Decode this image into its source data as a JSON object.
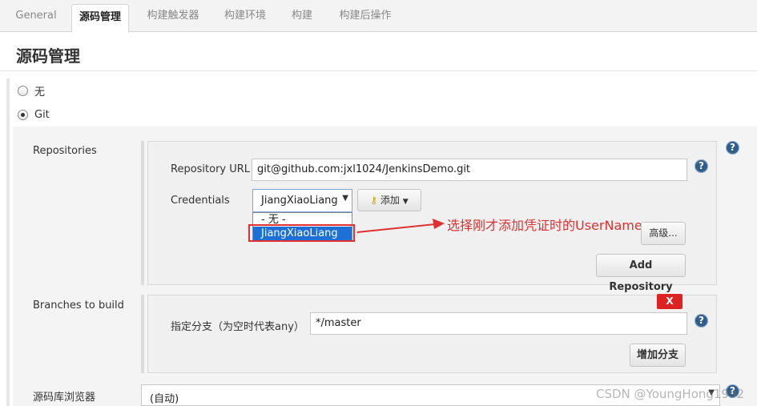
{
  "tabs": [
    {
      "label": "General",
      "active": false
    },
    {
      "label": "源码管理",
      "active": true
    },
    {
      "label": "构建触发器",
      "active": false
    },
    {
      "label": "构建环境",
      "active": false
    },
    {
      "label": "构建",
      "active": false
    },
    {
      "label": "构建后操作",
      "active": false
    }
  ],
  "section": {
    "title": "源码管理"
  },
  "scm_options": [
    {
      "label": "无",
      "checked": false
    },
    {
      "label": "Git",
      "checked": true
    }
  ],
  "repositories": {
    "label": "Repositories",
    "url_label": "Repository URL",
    "url_value": "git@github.com:jxl1024/JenkinsDemo.git",
    "credentials_label": "Credentials",
    "credentials_selected": "JiangXiaoLiang",
    "credentials_options": [
      "- 无 -",
      "JiangXiaoLiang"
    ],
    "add_label": "添加",
    "advanced_label": "高级...",
    "add_repository_label": "Add Repository"
  },
  "branches": {
    "label": "Branches to build",
    "delete_label": "X",
    "spec_label": "指定分支（为空时代表any）",
    "spec_value": "*/master",
    "add_branch_label": "增加分支"
  },
  "browser": {
    "label": "源码库浏览器",
    "value": "(自动)"
  },
  "annotation": {
    "text": "选择刚才添加凭证时的UserName",
    "color": "#e03030"
  },
  "help_icon": "?",
  "watermark": "CSDN @YoungHong1992"
}
